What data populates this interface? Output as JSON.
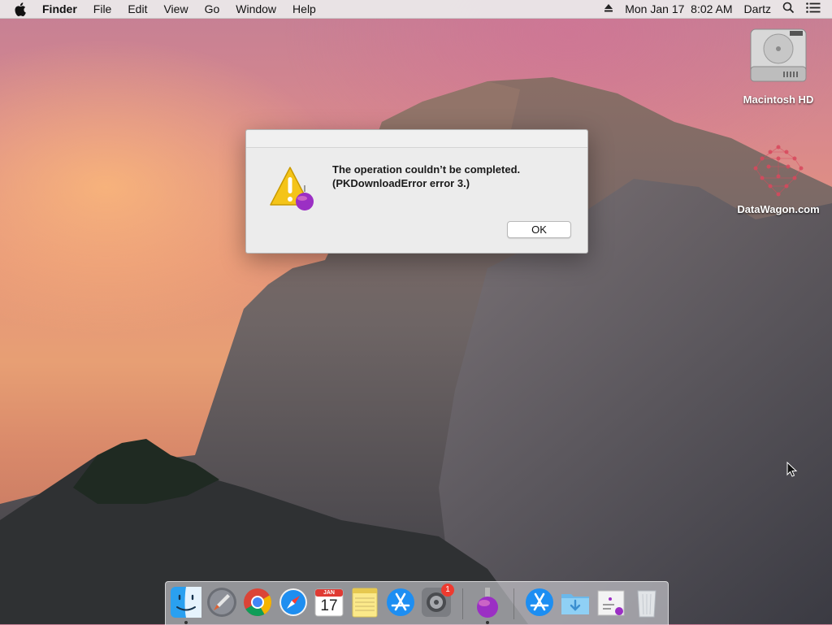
{
  "menubar": {
    "app_name": "Finder",
    "items": [
      "File",
      "Edit",
      "View",
      "Go",
      "Window",
      "Help"
    ],
    "clock": "Mon Jan 17  8:02 AM",
    "user": "Dartz"
  },
  "desktop": {
    "icons": [
      {
        "label": "Macintosh HD",
        "icon": "hard-drive-icon"
      },
      {
        "label": "DataWagon.com",
        "icon": "datawagon-logo-icon"
      }
    ]
  },
  "alert": {
    "message_line1": "The operation couldn’t be completed.",
    "message_line2": "(PKDownloadError error 3.)",
    "ok_label": "OK",
    "icon": "warning-icon"
  },
  "dock": {
    "apps": [
      {
        "name": "Finder",
        "icon": "finder-icon",
        "running": true
      },
      {
        "name": "Launchpad",
        "icon": "launchpad-icon",
        "running": false
      },
      {
        "name": "Google Chrome",
        "icon": "chrome-icon",
        "running": false
      },
      {
        "name": "Safari",
        "icon": "safari-icon",
        "running": false
      },
      {
        "name": "Calendar",
        "icon": "calendar-icon",
        "running": false
      },
      {
        "name": "Notes",
        "icon": "notes-icon",
        "running": false
      },
      {
        "name": "App Store",
        "icon": "app-store-icon",
        "running": false
      },
      {
        "name": "System Preferences",
        "icon": "system-preferences-icon",
        "running": false,
        "badge": "1"
      },
      {
        "name": "Installer",
        "icon": "installer-icon",
        "running": true
      },
      {
        "name": "Applications",
        "icon": "applications-folder-icon",
        "running": false
      },
      {
        "name": "Downloads",
        "icon": "downloads-folder-icon",
        "running": false
      },
      {
        "name": "Installer Package",
        "icon": "installer-package-icon",
        "running": false
      },
      {
        "name": "Trash",
        "icon": "trash-icon",
        "running": false
      }
    ],
    "calendar_month": "JAN",
    "calendar_day": "17"
  },
  "colors": {
    "badge_red": "#ee3a2f",
    "warning_yellow": "#f4c419",
    "installer_purple": "#9b2fc4"
  }
}
